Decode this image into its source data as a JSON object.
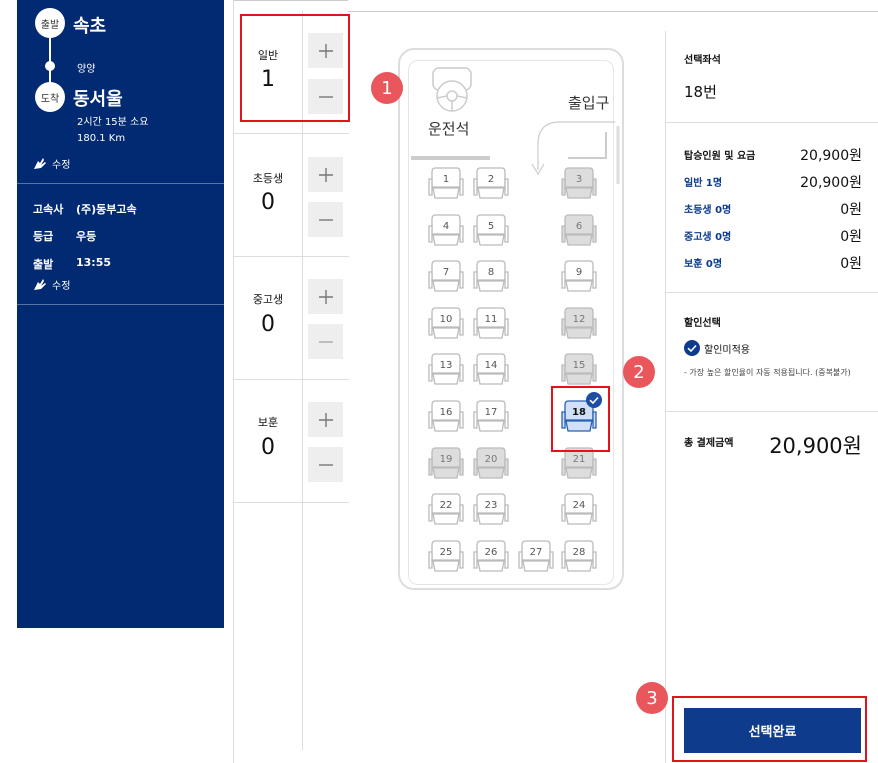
{
  "route": {
    "depart_badge": "출발",
    "depart_city": "속초",
    "via": "양양",
    "arrive_badge": "도착",
    "arrive_city": "동서울",
    "duration": "2시간 15분 소요",
    "distance": "180.1 Km",
    "edit_label": "수정"
  },
  "bus_info": {
    "company_label": "고속사",
    "company_value": "(주)동부고속",
    "grade_label": "등급",
    "grade_value": "우등",
    "depart_label": "출발",
    "depart_value": "13:55",
    "edit_label": "수정"
  },
  "passengers": [
    {
      "label": "일반",
      "count": "1"
    },
    {
      "label": "초등생",
      "count": "0"
    },
    {
      "label": "중고생",
      "count": "0"
    },
    {
      "label": "보훈",
      "count": "0"
    }
  ],
  "seat_map": {
    "driver_label": "운전석",
    "door_label": "출입구",
    "seats": [
      {
        "no": "1",
        "state": "available"
      },
      {
        "no": "2",
        "state": "available"
      },
      {
        "no": "3",
        "state": "sold"
      },
      {
        "no": "4",
        "state": "available"
      },
      {
        "no": "5",
        "state": "available"
      },
      {
        "no": "6",
        "state": "sold"
      },
      {
        "no": "7",
        "state": "available"
      },
      {
        "no": "8",
        "state": "available"
      },
      {
        "no": "9",
        "state": "available"
      },
      {
        "no": "10",
        "state": "available"
      },
      {
        "no": "11",
        "state": "available"
      },
      {
        "no": "12",
        "state": "sold"
      },
      {
        "no": "13",
        "state": "available"
      },
      {
        "no": "14",
        "state": "available"
      },
      {
        "no": "15",
        "state": "sold"
      },
      {
        "no": "16",
        "state": "available"
      },
      {
        "no": "17",
        "state": "available"
      },
      {
        "no": "18",
        "state": "selected"
      },
      {
        "no": "19",
        "state": "sold"
      },
      {
        "no": "20",
        "state": "sold"
      },
      {
        "no": "21",
        "state": "sold"
      },
      {
        "no": "22",
        "state": "available"
      },
      {
        "no": "23",
        "state": "available"
      },
      {
        "no": "24",
        "state": "available"
      },
      {
        "no": "25",
        "state": "available"
      },
      {
        "no": "26",
        "state": "available"
      },
      {
        "no": "27",
        "state": "available"
      },
      {
        "no": "28",
        "state": "available"
      }
    ]
  },
  "summary": {
    "selected_seat_label": "선택좌석",
    "selected_seat_value": "18번",
    "fare_label": "탑승인원 및 요금",
    "fare_value": "20,900원",
    "rows": [
      {
        "label": "일반 1명",
        "value": "20,900원"
      },
      {
        "label": "초등생 0명",
        "value": "0원"
      },
      {
        "label": "중고생 0명",
        "value": "0원"
      },
      {
        "label": "보훈 0명",
        "value": "0원"
      }
    ],
    "discount_label": "할인선택",
    "discount_option": "할인미적용",
    "discount_note": "- 가장 높은 할인율이 자동 적용됩니다. (중복불가)",
    "total_label": "총 결제금액",
    "total_value": "20,900원",
    "complete_button": "선택완료"
  },
  "markers": [
    "1",
    "2",
    "3"
  ],
  "colors": {
    "navy": "#012a73",
    "button": "#0e3b8c",
    "highlight": "#e0141b",
    "marker": "#e9565c"
  }
}
